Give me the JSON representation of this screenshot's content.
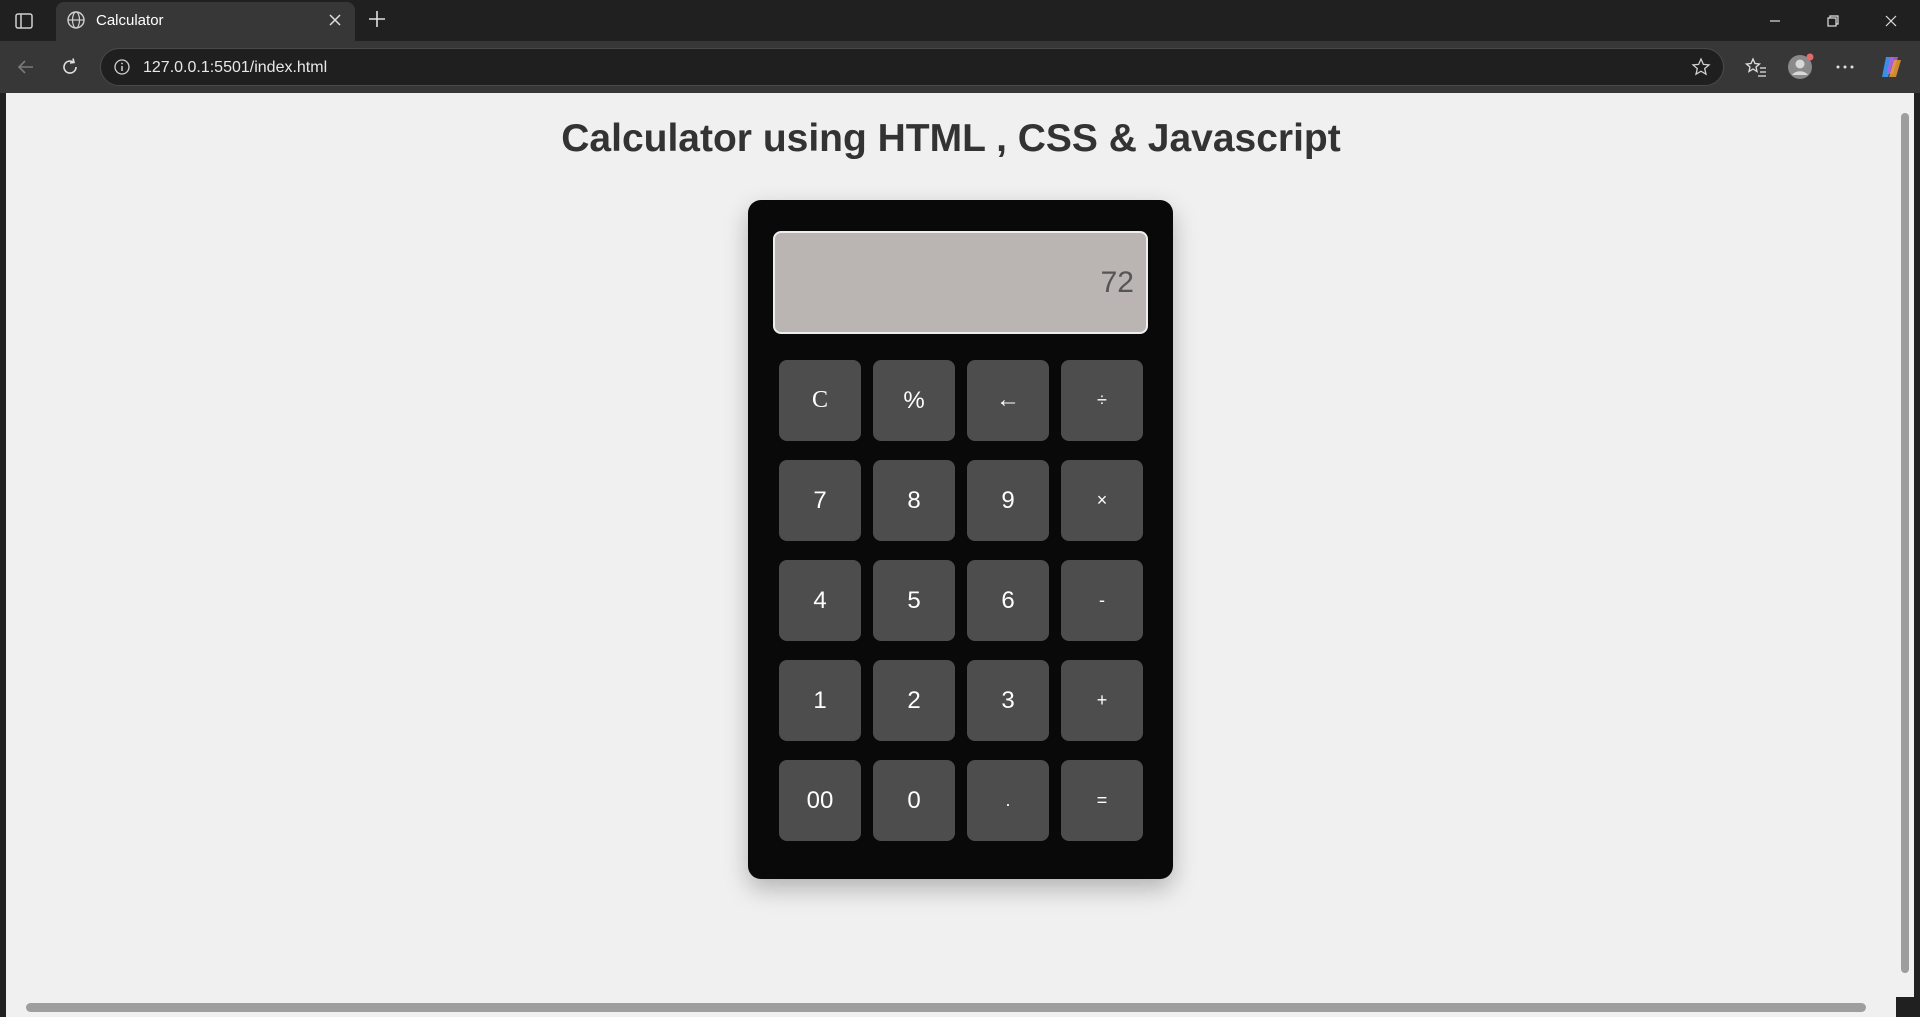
{
  "browser": {
    "tab_title": "Calculator",
    "url": "127.0.0.1:5501/index.html"
  },
  "page": {
    "heading": "Calculator using HTML , CSS & Javascript"
  },
  "calculator": {
    "display_value": "72",
    "keys": [
      "C",
      "%",
      "←",
      "÷",
      "7",
      "8",
      "9",
      "×",
      "4",
      "5",
      "6",
      "-",
      "1",
      "2",
      "3",
      "+",
      "00",
      "0",
      ".",
      "="
    ]
  },
  "colors": {
    "page_bg": "#f0f0f0",
    "calc_body": "#090909",
    "display_bg": "#bab4b3",
    "key_bg": "#4d4d4d"
  }
}
